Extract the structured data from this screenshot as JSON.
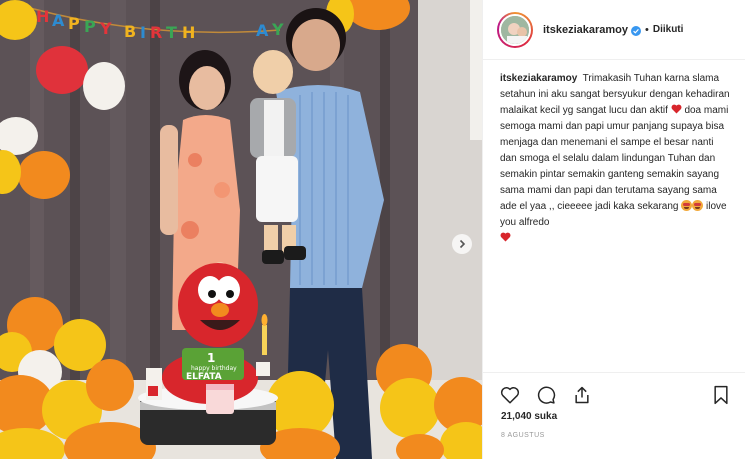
{
  "post": {
    "username": "itskeziakaramoy",
    "separator": "•",
    "follow_label": "Diikuti",
    "caption_user": "itskeziakaramoy",
    "caption_part1": "Trimakasih Tuhan karna slama setahun ini aku sangat bersyukur dengan kehadiran malaikat kecil yg sangat lucu dan aktif",
    "caption_part2": "doa mami semoga mami dan papi umur panjang supaya bisa menjaga dan menemani el sampe el besar nanti dan smoga el selalu dalam lindungan Tuhan dan semakin pintar semakin ganteng semakin sayang sama mami dan papi dan terutama sayang sama ade el yaa ,, cieeeee jadi kaka sekarang",
    "caption_part3": "ilove you alfredo",
    "likes": "21,040 suka",
    "date": "8 AGUSTUS"
  },
  "photo": {
    "banner_text": "HAPPY BIRTHDAY",
    "cake_text_small": "happy birthday",
    "cake_name": "ELFATA",
    "candle_number": "1"
  },
  "icons": {
    "verified": "verified-badge-icon",
    "like": "heart-icon",
    "comment": "comment-icon",
    "share": "share-icon",
    "save": "bookmark-icon",
    "next": "chevron-right-icon"
  },
  "colors": {
    "verified": "#3897f0",
    "heart": "#ed4956",
    "balloon_yellow": "#f5c518",
    "balloon_orange": "#f28a1e",
    "balloon_red": "#d8262c"
  }
}
